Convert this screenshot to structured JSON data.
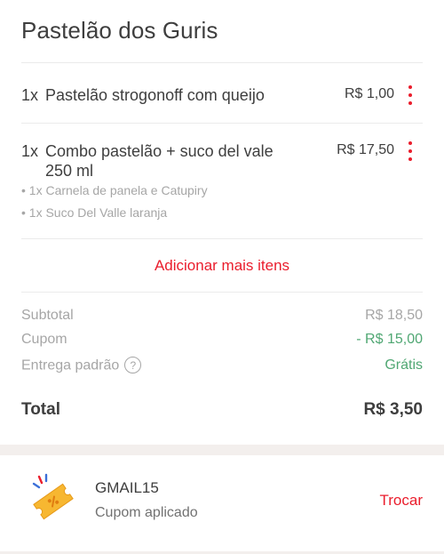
{
  "store": {
    "name": "Pastelão dos Guris"
  },
  "items": [
    {
      "qty": "1x",
      "name": "Pastelão strogonoff com queijo",
      "price": "R$ 1,00",
      "subitems": []
    },
    {
      "qty": "1x",
      "name": "Combo pastelão + suco del vale 250 ml",
      "price": "R$ 17,50",
      "subitems": [
        "• 1x Carnela de panela e Catupiry",
        "• 1x Suco Del Valle laranja"
      ]
    }
  ],
  "add_more_label": "Adicionar mais itens",
  "summary": {
    "subtotal_label": "Subtotal",
    "subtotal_value": "R$ 18,50",
    "coupon_label": "Cupom",
    "coupon_value": "- R$ 15,00",
    "delivery_label": "Entrega padrão",
    "delivery_help": "?",
    "delivery_value": "Grátis",
    "total_label": "Total",
    "total_value": "R$ 3,50"
  },
  "coupon": {
    "code": "GMAIL15",
    "status": "Cupom aplicado",
    "change_label": "Trocar"
  },
  "colors": {
    "accent": "#ea1d2c",
    "positive": "#50a773",
    "muted": "#a6a6a6",
    "text": "#3e3e3e"
  }
}
